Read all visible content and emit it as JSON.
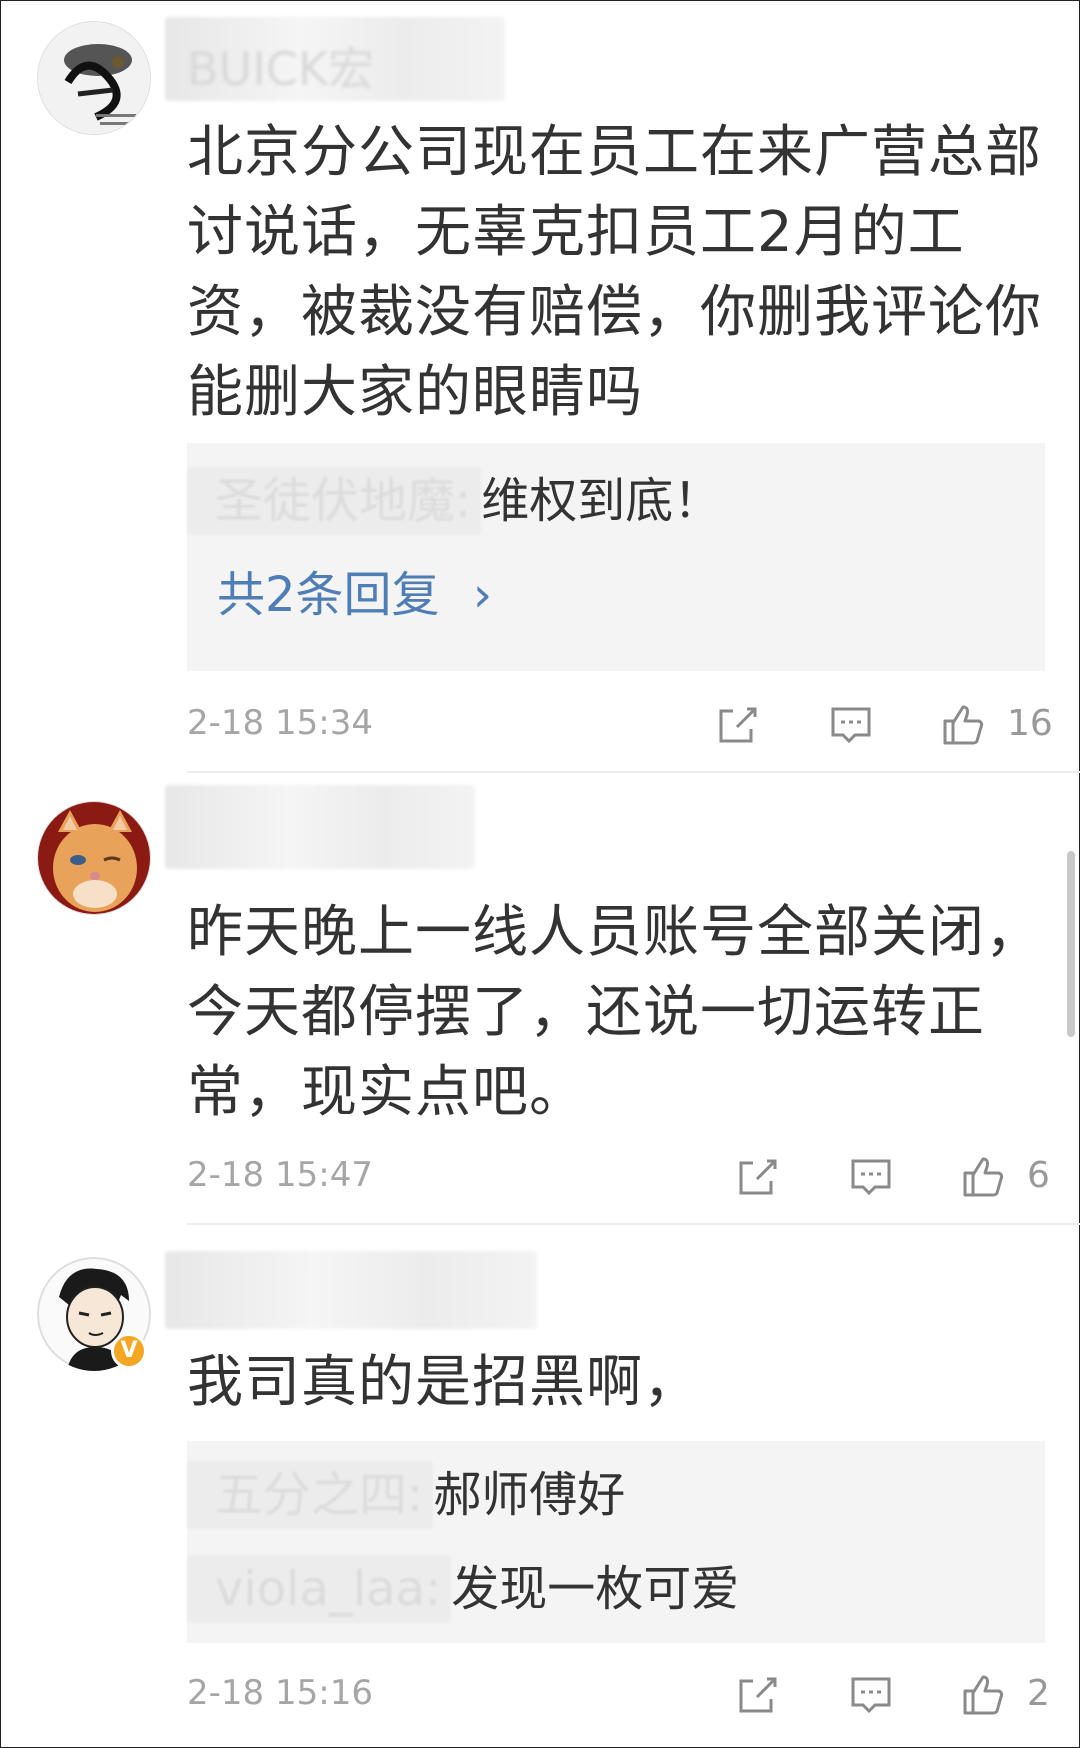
{
  "comments": [
    {
      "username": "BUICK宏",
      "text": "北京分公司现在员工在来广营总部讨说话，无辜克扣员工2月的工资，被裁没有赔偿，你删我评论你能删大家的眼睛吗",
      "replies": [
        {
          "user": "圣徒伏地魔:",
          "text": "维权到底！"
        }
      ],
      "more_replies": "共2条回复",
      "more_arrow": "›",
      "time": "2-18 15:34",
      "likes": "16"
    },
    {
      "username": "",
      "text": "昨天晚上一线人员账号全部关闭，今天都停摆了，还说一切运转正常，现实点吧。",
      "time": "2-18 15:47",
      "likes": "6"
    },
    {
      "username": "",
      "verified_badge": "V",
      "text": "我司真的是招黑啊，",
      "replies": [
        {
          "user": "五分之四:",
          "text": "郝师傅好"
        },
        {
          "user": "viola_laa:",
          "text": "发现一枚可爱"
        }
      ],
      "time": "2-18 15:16",
      "likes": "2"
    }
  ],
  "icons": {
    "repost": "repost-icon",
    "comment": "comment-icon",
    "like": "thumbs-up-icon"
  },
  "colors": {
    "link": "#4f7db5",
    "meta": "#a6a6a6",
    "badge": "#f5a623"
  }
}
